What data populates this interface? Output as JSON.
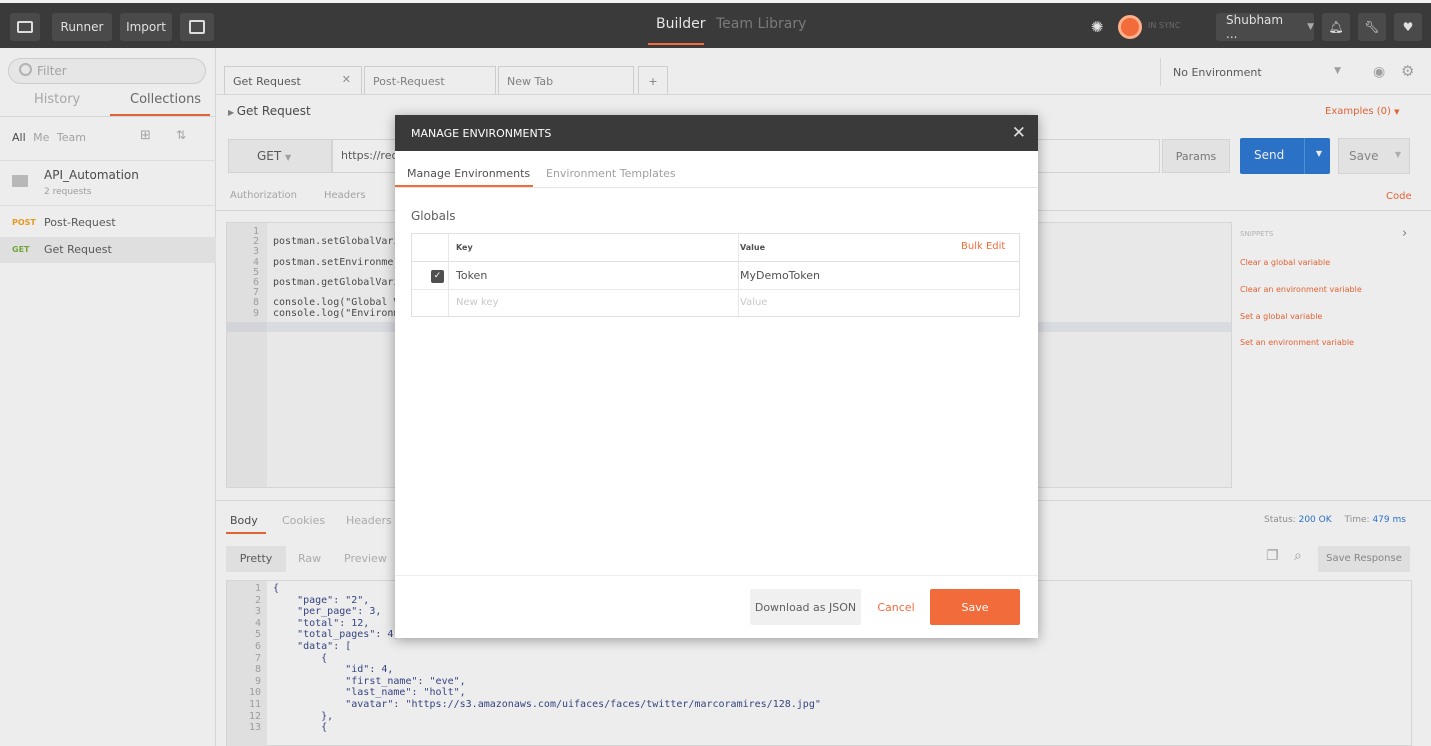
{
  "topbar": {
    "runner": "Runner",
    "import": "Import",
    "builder": "Builder",
    "team_library": "Team Library",
    "sync_status": "IN SYNC",
    "user": "Shubham ..."
  },
  "sidebar": {
    "filter_placeholder": "Filter",
    "tabs": [
      "History",
      "Collections"
    ],
    "scope": [
      "All",
      "Me",
      "Team"
    ],
    "collection": {
      "name": "API_Automation",
      "count": "2 requests"
    },
    "requests": [
      {
        "method": "POST",
        "name": "Post-Request"
      },
      {
        "method": "GET",
        "name": "Get Request"
      }
    ]
  },
  "main": {
    "tabs": [
      "Get Request",
      "Post-Request",
      "New Tab"
    ],
    "request_title": "Get Request",
    "examples": "Examples (0)",
    "environment": "No Environment",
    "method": "GET",
    "url": "https://req",
    "params": "Params",
    "send": "Send",
    "save": "Save",
    "req_tabs": [
      "Authorization",
      "Headers"
    ],
    "code": "Code",
    "script_lines": [
      "",
      "postman.setGlobalVari",
      "",
      "postman.setEnvironmer",
      "",
      "postman.getGlobalVari",
      "",
      "console.log(\"Global V",
      "console.log(\"Environm"
    ],
    "snippets_title": "SNIPPETS",
    "snippets": [
      "Clear a global variable",
      "Clear an environment variable",
      "Set a global variable",
      "Set an environment variable"
    ],
    "resp_tabs": [
      "Body",
      "Cookies",
      "Headers"
    ],
    "status_label": "Status:",
    "status_value": "200 OK",
    "time_label": "Time:",
    "time_value": "479 ms",
    "view_tabs": [
      "Pretty",
      "Raw",
      "Preview"
    ],
    "save_response": "Save Response",
    "response_lines": [
      {
        "n": "1",
        "t": "{"
      },
      {
        "n": "2",
        "t": "    \"page\": \"2\","
      },
      {
        "n": "3",
        "t": "    \"per_page\": 3,"
      },
      {
        "n": "4",
        "t": "    \"total\": 12,"
      },
      {
        "n": "5",
        "t": "    \"total_pages\": 4,"
      },
      {
        "n": "6",
        "t": "    \"data\": ["
      },
      {
        "n": "7",
        "t": "        {"
      },
      {
        "n": "8",
        "t": "            \"id\": 4,"
      },
      {
        "n": "9",
        "t": "            \"first_name\": \"eve\","
      },
      {
        "n": "10",
        "t": "            \"last_name\": \"holt\","
      },
      {
        "n": "11",
        "t": "            \"avatar\": \"https://s3.amazonaws.com/uifaces/faces/twitter/marcoramires/128.jpg\""
      },
      {
        "n": "12",
        "t": "        },"
      },
      {
        "n": "13",
        "t": "        {"
      }
    ]
  },
  "modal": {
    "title": "MANAGE ENVIRONMENTS",
    "tabs": [
      "Manage Environments",
      "Environment Templates"
    ],
    "section": "Globals",
    "col_key": "Key",
    "col_value": "Value",
    "bulk_edit": "Bulk Edit",
    "rows": [
      {
        "key": "Token",
        "value": "MyDemoToken"
      }
    ],
    "new_key_placeholder": "New key",
    "new_value_placeholder": "Value",
    "download": "Download as JSON",
    "cancel": "Cancel",
    "save": "Save"
  },
  "colors": {
    "accent": "#f26b3a",
    "send_blue": "#2f7bd6",
    "topbar": "#3a3a3a"
  }
}
